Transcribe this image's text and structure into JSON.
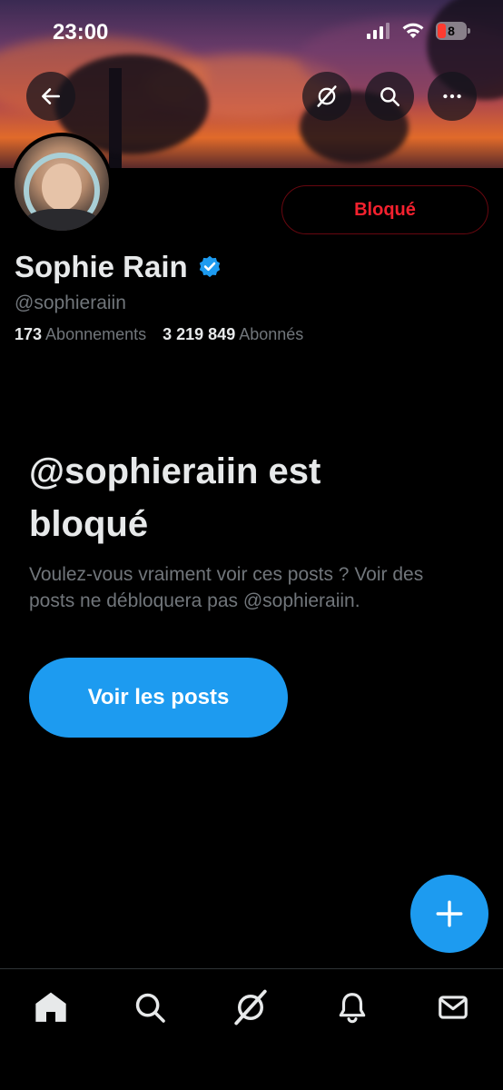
{
  "status_bar": {
    "time": "23:00",
    "battery_level": "8",
    "icons": [
      "signal-icon",
      "wifi-icon",
      "battery-icon"
    ]
  },
  "header": {
    "back_icon": "arrow-left-icon",
    "actions": [
      "grok-icon",
      "search-icon",
      "more-icon"
    ]
  },
  "profile": {
    "name": "Sophie Rain",
    "verified_icon": "verified-badge-icon",
    "handle": "@sophieraiin",
    "following_count": "173",
    "following_label": "Abonnements",
    "followers_count": "3 219 849",
    "followers_label": "Abonnés",
    "blocked_button_label": "Bloqué"
  },
  "blocked_notice": {
    "title": "@sophieraiin est bloqué",
    "description": "Voulez-vous vraiment voir ces posts ? Voir des posts ne débloquera pas @sophieraiin.",
    "view_button_label": "Voir les posts"
  },
  "fab_icon": "plus-icon",
  "tabbar": [
    "home-icon",
    "search-icon",
    "grok-icon",
    "bell-icon",
    "mail-icon"
  ],
  "colors": {
    "accent": "#1d9bf0",
    "danger": "#f4212e",
    "muted": "#71767b",
    "text": "#e7e9ea"
  }
}
